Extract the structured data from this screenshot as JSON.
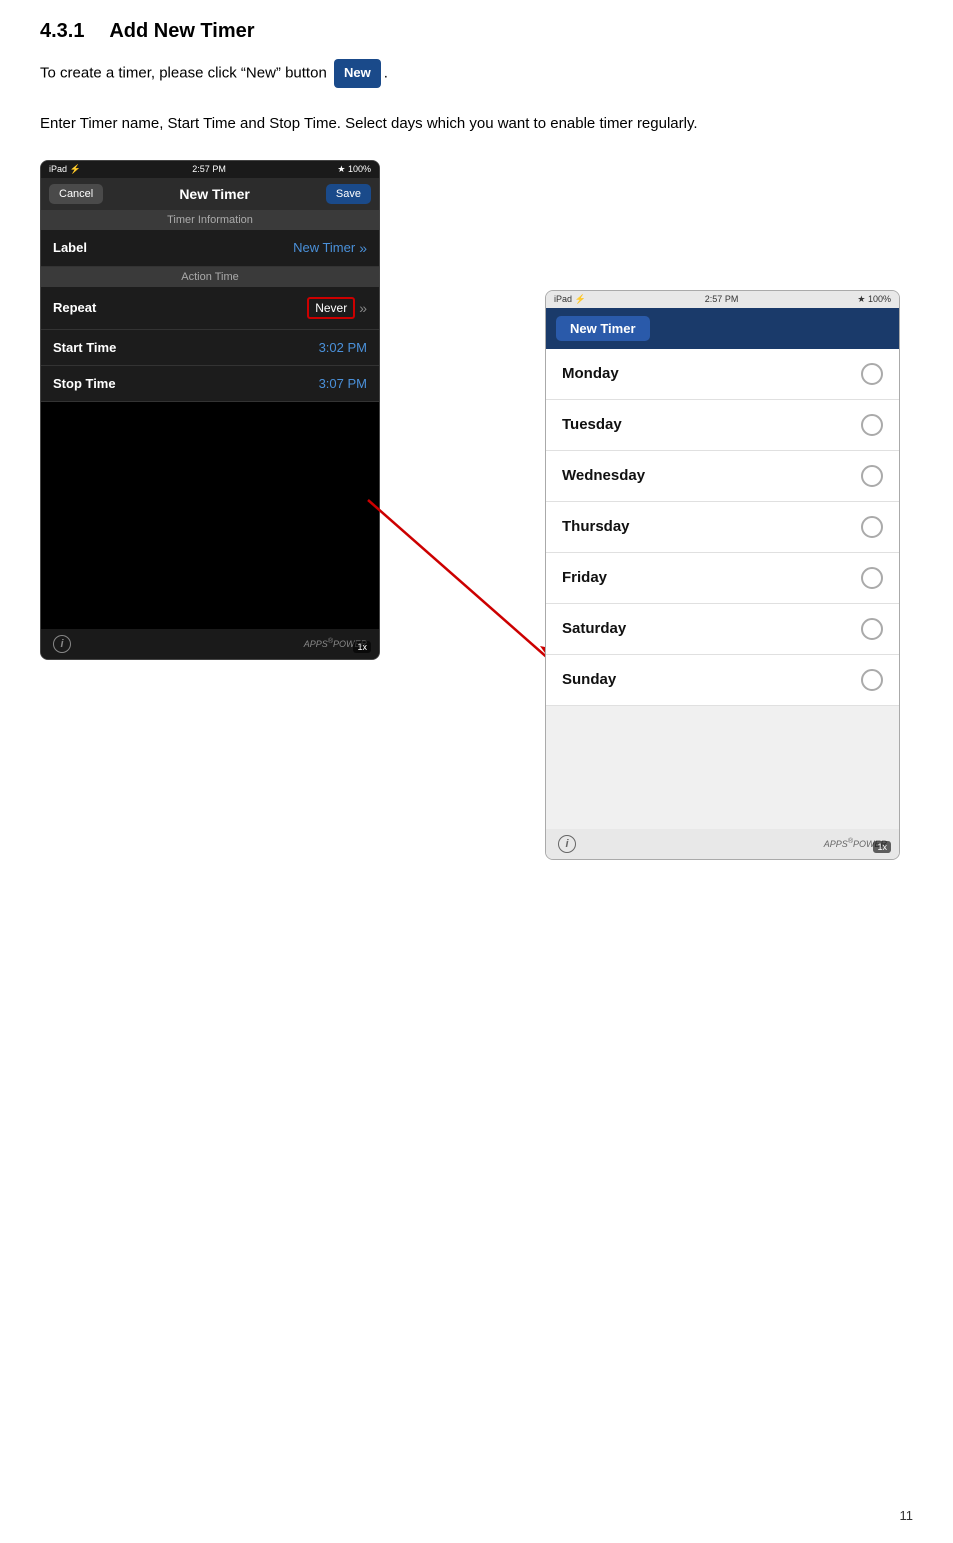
{
  "page": {
    "section": "4.3.1",
    "title": "Add New Timer",
    "intro_line1": "To create a timer, please click “New” button",
    "intro_line2": "Enter Timer name, Start Time and Stop Time. Select days which you want to enable timer regularly.",
    "new_button_label": "New",
    "page_number": "11"
  },
  "screenshot_left": {
    "status_bar": {
      "left": "iPad ⚡",
      "center": "2:57 PM",
      "right": "★ 100%"
    },
    "nav": {
      "cancel": "Cancel",
      "title": "New Timer",
      "save": "Save"
    },
    "section1_header": "Timer Information",
    "label_row": {
      "label": "Label",
      "value": "New Timer"
    },
    "section2_header": "Action Time",
    "repeat_row": {
      "label": "Repeat",
      "value": "Never"
    },
    "start_time_row": {
      "label": "Start Time",
      "value": "3:02 PM"
    },
    "stop_time_row": {
      "label": "Stop Time",
      "value": "3:07 PM"
    },
    "zoom": "1x"
  },
  "screenshot_right": {
    "status_bar": {
      "left": "iPad ⚡",
      "center": "2:57 PM",
      "right": "★ 100%"
    },
    "nav_title": "New Timer",
    "days": [
      "Monday",
      "Tuesday",
      "Wednesday",
      "Thursday",
      "Friday",
      "Saturday",
      "Sunday"
    ],
    "zoom": "1x"
  }
}
